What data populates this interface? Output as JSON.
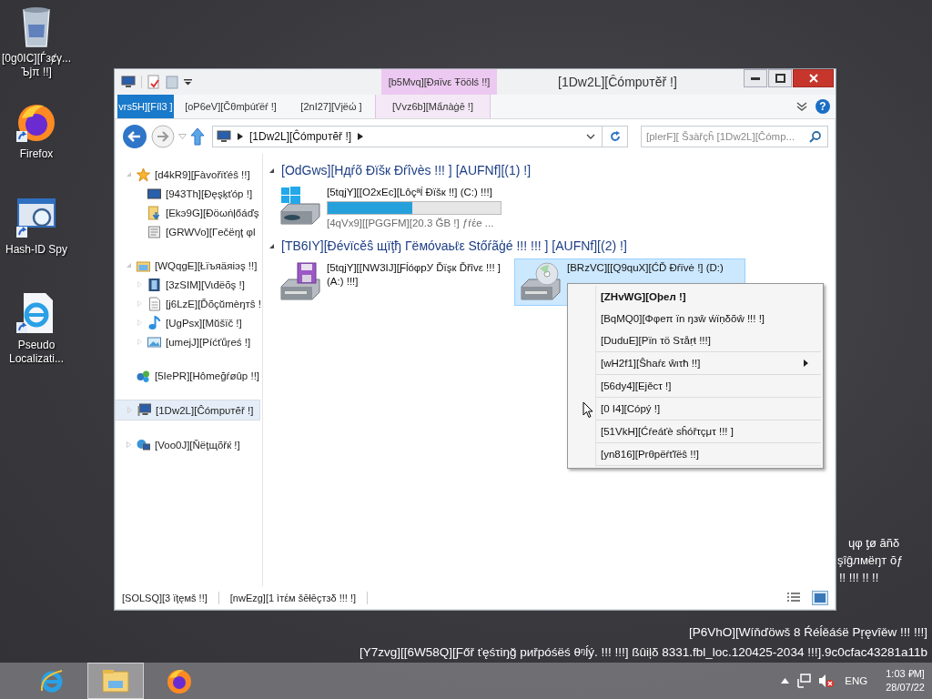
{
  "desktop": {
    "icons": [
      {
        "kind": "recycle-bin",
        "label_lines": [
          "[0g0IC][Ѓзȼγ...",
          "Ъјπ !!]"
        ]
      },
      {
        "kind": "firefox",
        "label_lines": [
          "Firefox"
        ]
      },
      {
        "kind": "hash-app",
        "label_lines": [
          "Hash-ID Spy"
        ]
      },
      {
        "kind": "ie-document",
        "label_lines": [
          "Pseudo",
          "Localizati..."
        ]
      }
    ],
    "behind_window_lines": [
      "ɥφ ƫø ăñδ",
      "şîĝлмëŋт ŏƒ",
      "!! !!! !! !!"
    ],
    "build_lines": [
      "[P6VhO][Wíňďöwš 8 Ŕéĺěáśë Pŗęvîěw !!! !!!]",
      "[Y7zvg][[6W58Q][Ƒőř ťęśτiŋğ pиřpóśëś θᵑĺý. !!! !!!] ßûiļδ 8331.fbl_loc.120425-2034 !!!].9c0cfac43281a11b"
    ]
  },
  "window": {
    "title": "[1Dw2L][Ĉómpυтĕř !]",
    "context_tab_group": "[b5Mvq][Đяïvε Ŧöölś !!]",
    "tabs": [
      {
        "label": "vrs5H][Fíl3 ]",
        "selected": true,
        "kind": "file"
      },
      {
        "label": "[oP6eV][Čθmþúťëŕ !]",
        "selected": false,
        "kind": "normal"
      },
      {
        "label": "[2nI27][Vįëώ ]",
        "selected": false,
        "kind": "normal"
      },
      {
        "label": "[Vvz6b][Mẩлàġē !]",
        "selected": false,
        "kind": "contextual"
      }
    ],
    "help_glyph": "?",
    "address": {
      "path": "[1Dw2L][Ĉómpυтĕř !]"
    },
    "search": {
      "placeholder": "[plerF][ Šзàřçĥ [1Dw2L][Ĉómp..."
    },
    "nav": [
      {
        "kind": "star",
        "label": "[d4kR9][Ƒàvořïťéŝ !!]",
        "expanded": true,
        "selected": false,
        "children": [
          {
            "kind": "desktop",
            "label": "[943Th][Đęşķťóp !]",
            "selected": false
          },
          {
            "kind": "downloads",
            "label": "[Ekэ9G][Đöωṅļőáďş",
            "selected": false
          },
          {
            "kind": "recent",
            "label": "[GRWVo][Гečёŋţ φl",
            "selected": false
          }
        ]
      },
      {
        "kind": "library",
        "label": "[WQqgE][Łïъяäяiэş !!]",
        "expanded": true,
        "selected": false,
        "children": [
          {
            "kind": "videos",
            "label": "[3zSIM][Vɩđëõş !]",
            "expanded": false,
            "selected": false
          },
          {
            "kind": "documents",
            "label": "[j6LzE][Ďõçŭmèŋтŝ !",
            "expanded": false,
            "selected": false
          },
          {
            "kind": "music",
            "label": "[UgPsx][Mŭšïč !]",
            "expanded": false,
            "selected": false
          },
          {
            "kind": "pictures",
            "label": "[umejJ][Píćťůŗeś !]",
            "expanded": false,
            "selected": false
          }
        ]
      },
      {
        "kind": "homegroup",
        "label": "[5IePR][Hômeğŕøûp !!]",
        "selected": false
      },
      {
        "kind": "computer",
        "label": "[1Dw2L][Ĉómpυтĕř !]",
        "expanded": false,
        "selected": true
      },
      {
        "kind": "network",
        "label": "[Voo0J][Ňëţщõřќ !]",
        "expanded": false,
        "selected": false
      }
    ],
    "groups": [
      {
        "title": "[OdGws][Hдŕõ Đïšк Đŕîvès !!! ] [AUFNf][(1) !]",
        "expanded": true,
        "items": [
          {
            "kind": "hdd-windows",
            "name": "[5tqjY][[O2xEc][Lôçªĺ Đïšк !!] (C:) !!!]",
            "level": 0.49,
            "free": "[4qVx9][[PGGFM][20.3 ĞB !] ƒŕέe ...",
            "selected": false
          }
        ]
      },
      {
        "title": "[TB6IY][Đévïcěŝ щïţђ Гёмóνаьℓε Stőŕãģé !!! !!! ] [AUFNf][(2) !]",
        "expanded": true,
        "items": [
          {
            "kind": "floppy",
            "name": "[5tqjY][[NW3IJ][ƑĺóφpУ Ďïşк Ďřîvε !!! ] (A:) !!!]",
            "selected": false
          },
          {
            "kind": "cd",
            "name": "[BRzVC][[Q9quX][ĆĎ Đŕïvė !] (D:)",
            "selected": true
          }
        ]
      }
    ],
    "context_menu": {
      "sections": [
        [
          {
            "kind": "default",
            "label": "[ZHvWG][Oþeл !]"
          },
          {
            "kind": "item",
            "label": "[BqMQ0][Φφeπ ïn ŋзŵ ẃïṇδõŵ !!! !]"
          },
          {
            "kind": "item",
            "label": "[DuduE][Pïn τö Sτåṛŧ !!!]"
          }
        ],
        [
          {
            "kind": "submenu",
            "label": "[wH2f1][Ŝhaŕε ŵιτħ !!]"
          }
        ],
        [
          {
            "kind": "item",
            "label": "[56dy4][Ejěcτ !]"
          }
        ],
        [
          {
            "kind": "item",
            "label": "[0  I4][Cópý !]"
          }
        ],
        [
          {
            "kind": "item",
            "label": "[51VkH][Ćŕeáťè sĥóřτçμτ !!! ]"
          }
        ],
        [
          {
            "kind": "item",
            "label": "[yn816][Prθpëŕťĩëŝ !!]"
          }
        ]
      ]
    },
    "status_bar": {
      "items_count": "[SOLSQ][3 їţęмš !!]",
      "selection": "[nwEzg][1 ìтέм šēłēçтзδ !!! !]"
    }
  },
  "taskbar": {
    "apps": [
      {
        "kind": "ie",
        "selected": false
      },
      {
        "kind": "explorer",
        "selected": true
      },
      {
        "kind": "firefox",
        "selected": false
      }
    ],
    "language": "ENG",
    "time": "1:03 ₽M]",
    "date": "28/07/22"
  }
}
